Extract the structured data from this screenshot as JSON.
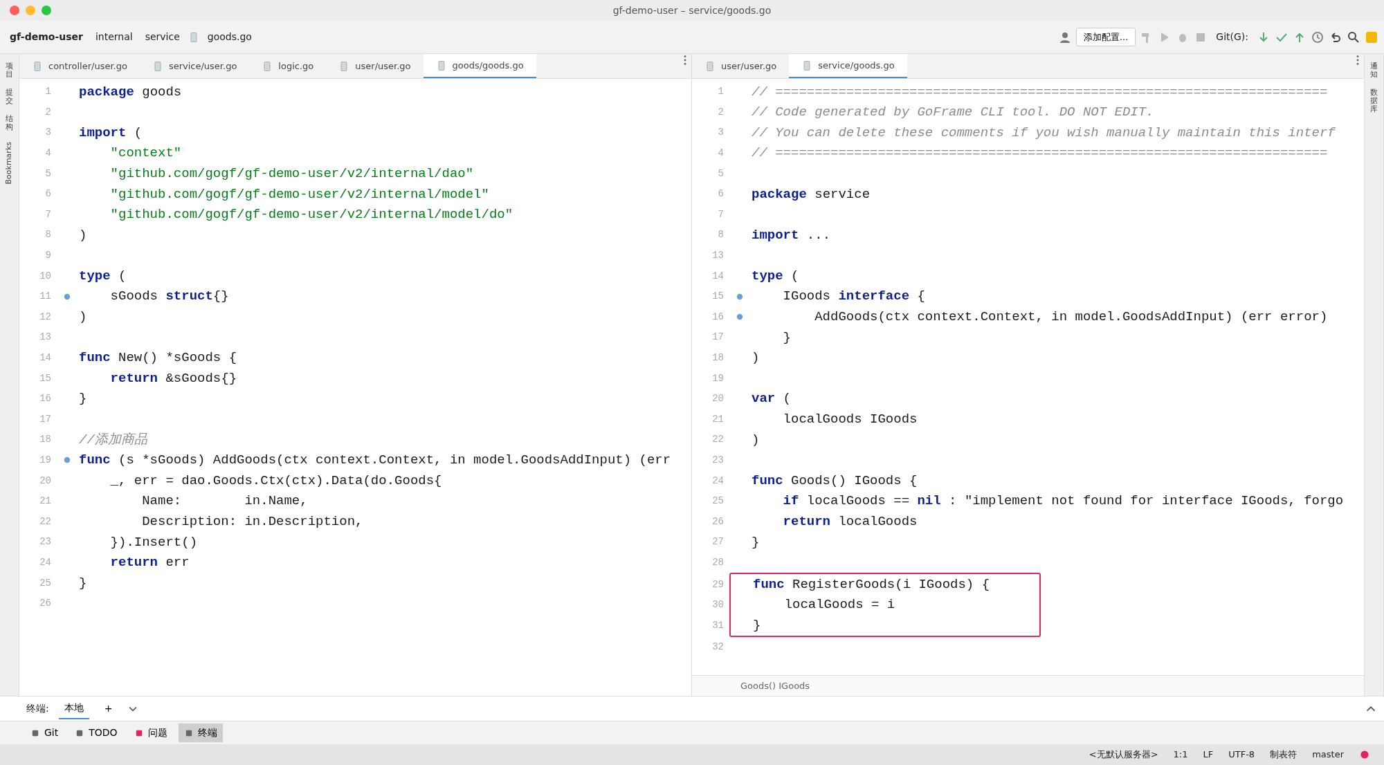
{
  "window": {
    "title": "gf-demo-user – service/goods.go"
  },
  "breadcrumb": [
    "gf-demo-user",
    "internal",
    "service",
    "goods.go"
  ],
  "toolbar": {
    "config_button": "添加配置...",
    "git_label": "Git(G):"
  },
  "left_strip": [
    {
      "label": "项目"
    },
    {
      "label": "提交"
    },
    {
      "label": "结构"
    },
    {
      "label": "Bookmarks"
    }
  ],
  "right_strip": [
    {
      "label": "通知"
    },
    {
      "label": "数据库"
    }
  ],
  "editors": [
    {
      "tabs": [
        {
          "label": "controller/user.go",
          "selected": false
        },
        {
          "label": "service/user.go",
          "selected": false
        },
        {
          "label": "logic.go",
          "selected": false
        },
        {
          "label": "user/user.go",
          "selected": false
        },
        {
          "label": "goods/goods.go",
          "selected": true
        }
      ],
      "lines": [
        {
          "num": "1",
          "text": "**package** goods",
          "kind": "code",
          "marker": false
        },
        {
          "num": "2",
          "marker": false
        },
        {
          "num": "3",
          "text": "**import** (",
          "kind": "code",
          "marker": false
        },
        {
          "num": "4",
          "text": "    \"context\"",
          "kind": "string",
          "marker": false
        },
        {
          "num": "5",
          "text": "    \"github.com/gogf/gf-demo-user/v2/internal/dao\"",
          "kind": "string",
          "marker": false
        },
        {
          "num": "6",
          "text": "    \"github.com/gogf/gf-demo-user/v2/internal/model\"",
          "kind": "string",
          "marker": false
        },
        {
          "num": "7",
          "text": "    \"github.com/gogf/gf-demo-user/v2/internal/model/do\"",
          "kind": "string",
          "marker": false
        },
        {
          "num": "8",
          "text": ")",
          "kind": "code",
          "marker": false
        },
        {
          "num": "9",
          "marker": false
        },
        {
          "num": "10",
          "text": "**type** (",
          "kind": "code",
          "marker": false
        },
        {
          "num": "11",
          "text": "    sGoods **struct**{}",
          "kind": "code",
          "marker": true
        },
        {
          "num": "12",
          "text": ")",
          "kind": "code",
          "marker": false
        },
        {
          "num": "13",
          "marker": false
        },
        {
          "num": "14",
          "text": "**func** New() *sGoods {",
          "kind": "code",
          "marker": false
        },
        {
          "num": "15",
          "text": "    **return** &sGoods{}",
          "kind": "code",
          "marker": false
        },
        {
          "num": "16",
          "text": "}",
          "kind": "code",
          "marker": false
        },
        {
          "num": "17",
          "marker": false
        },
        {
          "num": "18",
          "text": "//添加商品",
          "kind": "comment",
          "marker": false
        },
        {
          "num": "19",
          "text": "**func** (s *sGoods) AddGoods(ctx context.Context, in model.GoodsAddInput) (err",
          "kind": "code",
          "marker": true
        },
        {
          "num": "20",
          "text": "    _, err = dao.Goods.Ctx(ctx).Data(do.Goods{",
          "kind": "code",
          "marker": false
        },
        {
          "num": "21",
          "text": "        Name:        in.Name,",
          "kind": "code",
          "marker": false
        },
        {
          "num": "22",
          "text": "        Description: in.Description,",
          "kind": "code",
          "marker": false
        },
        {
          "num": "23",
          "text": "    }).Insert()",
          "kind": "code",
          "marker": false
        },
        {
          "num": "24",
          "text": "    **return** err",
          "kind": "code",
          "marker": false
        },
        {
          "num": "25",
          "text": "}",
          "kind": "code",
          "marker": false
        },
        {
          "num": "26",
          "marker": false
        }
      ]
    },
    {
      "tabs": [
        {
          "label": "user/user.go",
          "selected": false
        },
        {
          "label": "service/goods.go",
          "selected": true
        }
      ],
      "footer": "Goods() IGoods",
      "lines": [
        {
          "num": "1",
          "text": "// ======================================================================",
          "kind": "comment",
          "marker": false,
          "boxed": false
        },
        {
          "num": "2",
          "text": "// Code generated by GoFrame CLI tool. DO NOT EDIT.",
          "kind": "comment",
          "marker": false,
          "boxed": false
        },
        {
          "num": "3",
          "text": "// You can delete these comments if you wish manually maintain this interf",
          "kind": "comment",
          "marker": false,
          "boxed": false
        },
        {
          "num": "4",
          "text": "// ======================================================================",
          "kind": "comment",
          "marker": false,
          "boxed": false
        },
        {
          "num": "5",
          "marker": false,
          "boxed": false
        },
        {
          "num": "6",
          "text": "**package** service",
          "kind": "code",
          "marker": false,
          "boxed": false
        },
        {
          "num": "7",
          "marker": false,
          "boxed": false
        },
        {
          "num": "8",
          "text": "**import** ...",
          "kind": "code",
          "marker": false,
          "boxed": false
        },
        {
          "num": "13",
          "marker": false,
          "boxed": false
        },
        {
          "num": "14",
          "text": "**type** (",
          "kind": "code",
          "marker": false,
          "boxed": false
        },
        {
          "num": "15",
          "text": "    IGoods **interface** {",
          "kind": "code",
          "marker": true,
          "boxed": false
        },
        {
          "num": "16",
          "text": "        AddGoods(ctx context.Context, in model.GoodsAddInput) (err error)",
          "kind": "code",
          "marker": true,
          "boxed": false
        },
        {
          "num": "17",
          "text": "    }",
          "kind": "code",
          "marker": false,
          "boxed": false
        },
        {
          "num": "18",
          "text": ")",
          "kind": "code",
          "marker": false,
          "boxed": false
        },
        {
          "num": "19",
          "marker": false,
          "boxed": false
        },
        {
          "num": "20",
          "text": "**var** (",
          "kind": "code",
          "marker": false,
          "boxed": false
        },
        {
          "num": "21",
          "text": "    localGoods IGoods",
          "kind": "code",
          "marker": false,
          "boxed": false
        },
        {
          "num": "22",
          "text": ")",
          "kind": "code",
          "marker": false,
          "boxed": false
        },
        {
          "num": "23",
          "marker": false,
          "boxed": false
        },
        {
          "num": "24",
          "text": "**func** Goods() IGoods {",
          "kind": "code",
          "marker": false,
          "boxed": false
        },
        {
          "num": "25",
          "text": "    **if** localGoods == **nil** : \"implement not found for interface IGoods, forgo",
          "kind": "code",
          "marker": false,
          "boxed": false
        },
        {
          "num": "26",
          "text": "    **return** localGoods",
          "kind": "code",
          "marker": false,
          "boxed": false
        },
        {
          "num": "27",
          "text": "}",
          "kind": "code",
          "marker": false,
          "boxed": false
        },
        {
          "num": "28",
          "marker": false,
          "boxed": false
        },
        {
          "num": "29",
          "text": "**func** RegisterGoods(i IGoods) {",
          "kind": "code",
          "marker": false,
          "boxed": true
        },
        {
          "num": "30",
          "text": "    localGoods = i",
          "kind": "code",
          "marker": false,
          "boxed": true
        },
        {
          "num": "31",
          "text": "}",
          "kind": "code",
          "marker": false,
          "boxed": true
        },
        {
          "num": "32",
          "marker": false,
          "boxed": false
        }
      ]
    }
  ],
  "terminal": {
    "label": "终端:",
    "tabs": [
      {
        "label": "本地",
        "selected": true
      }
    ],
    "add": "+"
  },
  "tool_tabs": [
    {
      "label": "Git",
      "selected": false
    },
    {
      "label": "TODO",
      "selected": false
    },
    {
      "label": "问题",
      "selected": false
    },
    {
      "label": "终端",
      "selected": true
    }
  ],
  "status_bar": [
    "<无默认服务器>",
    "1:1",
    "LF",
    "UTF-8",
    "制表符",
    "master"
  ]
}
